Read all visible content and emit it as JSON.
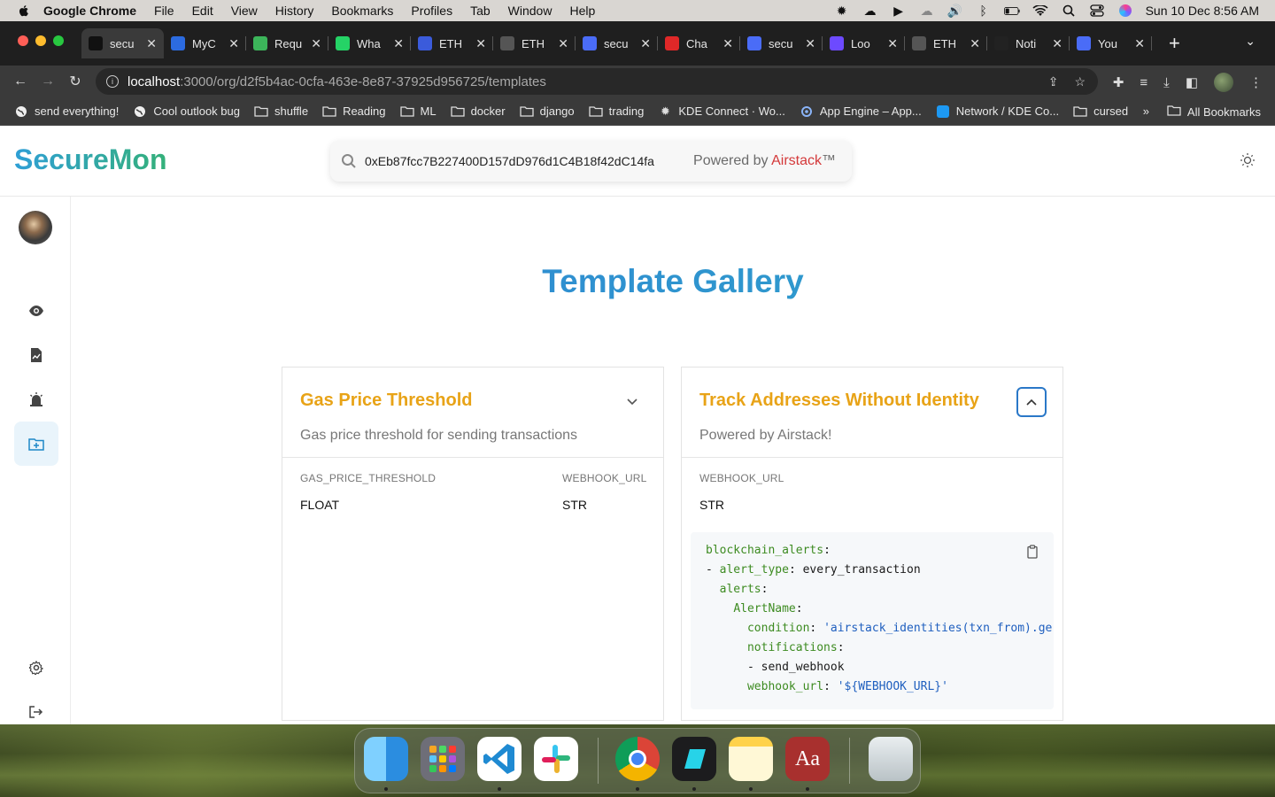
{
  "menubar": {
    "app_name": "Google Chrome",
    "items": [
      "File",
      "Edit",
      "View",
      "History",
      "Bookmarks",
      "Profiles",
      "Tab",
      "Window",
      "Help"
    ],
    "clock": "Sun 10 Dec  8:56 AM"
  },
  "browser": {
    "tabs": [
      {
        "label": "secu",
        "icon": "airstack-icon",
        "color": "#111111",
        "active": true
      },
      {
        "label": "MyC",
        "icon": "myc-icon",
        "color": "#2c6be0",
        "active": false
      },
      {
        "label": "Requ",
        "icon": "pushbullet-icon",
        "color": "#3cb55a",
        "active": false
      },
      {
        "label": "Wha",
        "icon": "whatsapp-icon",
        "color": "#25d366",
        "active": false
      },
      {
        "label": "ETH",
        "icon": "eth-icon",
        "color": "#3b5bdb",
        "active": false
      },
      {
        "label": "ETH",
        "icon": "github-icon",
        "color": "#555555",
        "active": false
      },
      {
        "label": "secu",
        "icon": "gear-flower-icon",
        "color": "#4a6cf7",
        "active": false
      },
      {
        "label": "Cha",
        "icon": "youtube-icon",
        "color": "#e02828",
        "active": false
      },
      {
        "label": "secu",
        "icon": "gear-flower-icon",
        "color": "#4a6cf7",
        "active": false
      },
      {
        "label": "Loo",
        "icon": "linear-icon",
        "color": "#6d4aff",
        "active": false
      },
      {
        "label": "ETH",
        "icon": "github-icon",
        "color": "#555555",
        "active": false
      },
      {
        "label": "Noti",
        "icon": "x-icon",
        "color": "#222222",
        "active": false
      },
      {
        "label": "You",
        "icon": "gear-flower-icon",
        "color": "#4a6cf7",
        "active": false
      }
    ],
    "url_host": "localhost",
    "url_path": ":3000/org/d2f5b4ac-0cfa-463e-8e87-37925d956725/templates",
    "bookmarks": [
      {
        "label": "send everything!",
        "icon": "globe-icon"
      },
      {
        "label": "Cool outlook bug",
        "icon": "globe-icon"
      },
      {
        "label": "shuffle",
        "icon": "folder-icon"
      },
      {
        "label": "Reading",
        "icon": "folder-icon"
      },
      {
        "label": "ML",
        "icon": "folder-icon"
      },
      {
        "label": "docker",
        "icon": "folder-icon"
      },
      {
        "label": "django",
        "icon": "folder-icon"
      },
      {
        "label": "trading",
        "icon": "folder-icon"
      },
      {
        "label": "KDE Connect · Wo...",
        "icon": "gear-icon"
      },
      {
        "label": "App Engine – App...",
        "icon": "app-engine-icon"
      },
      {
        "label": "Network / KDE Co...",
        "icon": "kde-icon"
      },
      {
        "label": "cursed",
        "icon": "folder-icon"
      }
    ],
    "bookmarks_more": "»",
    "all_bookmarks": "All Bookmarks"
  },
  "app": {
    "brand": "SecureMon",
    "search_value": "0xEb87fcc7B227400D157dD976d1C4B18f42dC14fa",
    "powered_prefix": "Powered by ",
    "powered_brand": "Airstack",
    "powered_suffix": "™",
    "page_title": "Template Gallery"
  },
  "cards": [
    {
      "title": "Gas Price Threshold",
      "description": "Gas price threshold for sending transactions",
      "expanded": false,
      "params": [
        {
          "name": "GAS_PRICE_THRESHOLD",
          "type": "FLOAT"
        },
        {
          "name": "WEBHOOK_URL",
          "type": "STR"
        }
      ]
    },
    {
      "title": "Track Addresses Without Identity",
      "description": "Powered by Airstack!",
      "expanded": true,
      "params": [
        {
          "name": "WEBHOOK_URL",
          "type": "STR"
        }
      ],
      "code": {
        "l1_key": "blockchain_alerts",
        "l2_dash": "- ",
        "l2_key": "alert_type",
        "l2_val": "every_transaction",
        "l3_key": "alerts",
        "l4_key": "AlertName",
        "l5_key": "condition",
        "l5_val": "'airstack_identities(txn_from).ge",
        "l6_key": "notifications",
        "l7_val": "- send_webhook",
        "l8_key": "webhook_url",
        "l8_val": "'${WEBHOOK_URL}'"
      }
    }
  ],
  "colors": {
    "brand_gradient_start": "#2f9fd6",
    "brand_gradient_end": "#34b07a",
    "card_title": "#e8a317",
    "active_sidebar_bg": "#e9f4fb",
    "accent_blue": "#2a78c8"
  }
}
